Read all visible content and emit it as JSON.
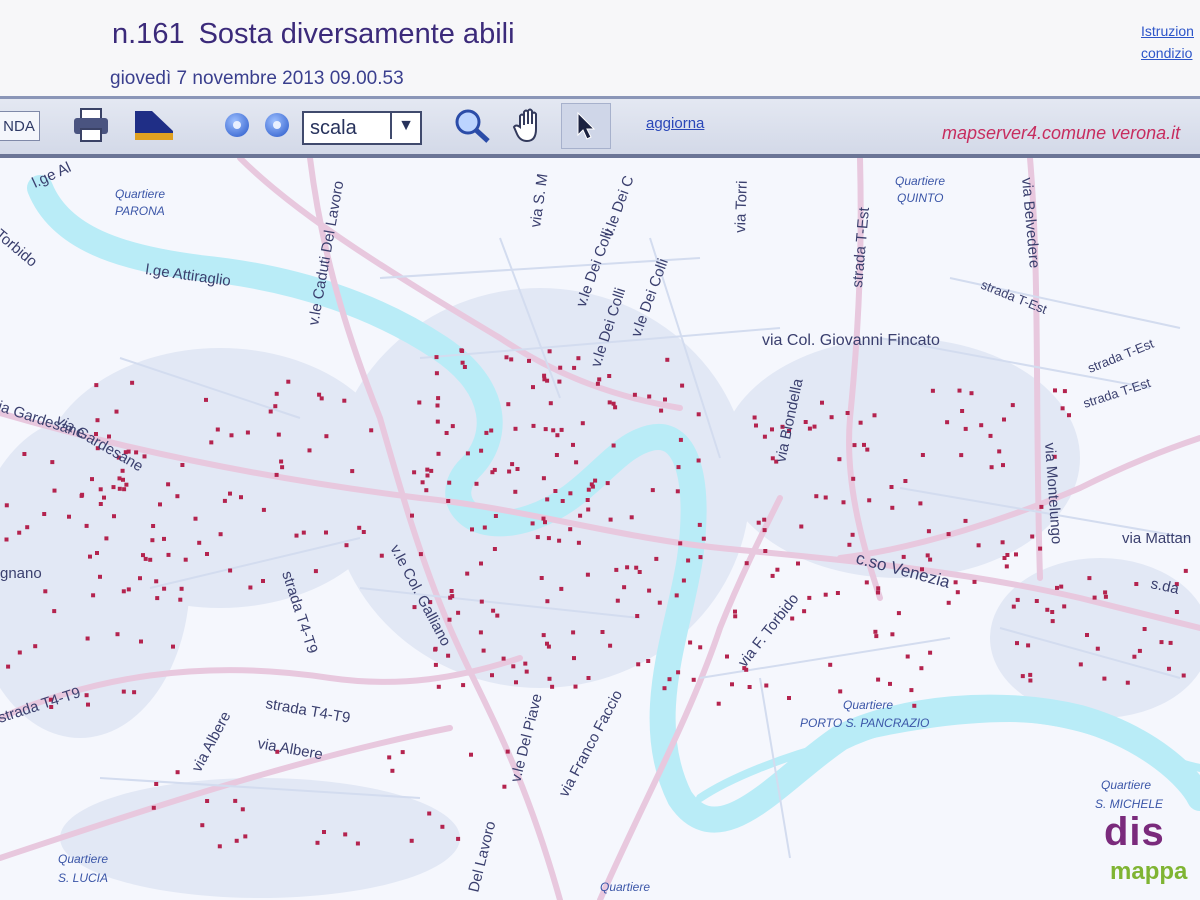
{
  "header": {
    "number": "n.161",
    "title": "Sosta diversamente abili",
    "datetime": "giovedì 7 novembre 2013 09.00.53",
    "links": [
      "Istruzion",
      "condizio"
    ]
  },
  "toolbar": {
    "legend_label": "NDA",
    "scale_value": "scala",
    "refresh_label": "aggiorna",
    "server_label": "mapserver4.comune verona.it"
  },
  "map": {
    "streets": [
      "l.ge Attiraglio",
      "v.le Caduti Del Lavoro",
      "via S. M",
      "v.le Dei C",
      "v.le Dei Colli",
      "v.le Dei Colli",
      "v.le Dei Colli",
      "via Torri",
      "via Col. Giovanni Fincato",
      "via Biondella",
      "strada T-Est",
      "via Belvedere",
      "strada T-Est",
      "strada T-Est",
      "strada T-Est",
      "via Montelungo",
      "via Mattan",
      "s.da",
      "c.so Venezia",
      "via F. Torbido",
      "via Gardesane",
      "via Gardesane",
      "gnano",
      "strada T4-T9",
      "v.le Col. Galliano",
      "strada T4-T9",
      "strada T4-T9",
      "via Albere",
      "via Albere",
      "v.le Del Piave",
      "via Franco Faccio",
      "Del Lavoro",
      "l.ge Al",
      "a Torbido"
    ],
    "quartieri": [
      {
        "line1": "Quartiere",
        "line2": "PARONA"
      },
      {
        "line1": "Quartiere",
        "line2": "QUINTO"
      },
      {
        "line1": "Quartiere",
        "line2": "PORTO S. PANCRAZIO"
      },
      {
        "line1": "Quartiere",
        "line2": "S. MICHELE"
      },
      {
        "line1": "Quartiere",
        "line2": "S. LUCIA"
      },
      {
        "line1": "Quartiere",
        "line2": ""
      }
    ]
  },
  "watermark": {
    "top": "dis",
    "bottom": "mappa"
  },
  "colors": {
    "river": "#b9ecf7",
    "road": "#e8c8de",
    "marker": "#b4234e",
    "title": "#3b2a7a"
  }
}
